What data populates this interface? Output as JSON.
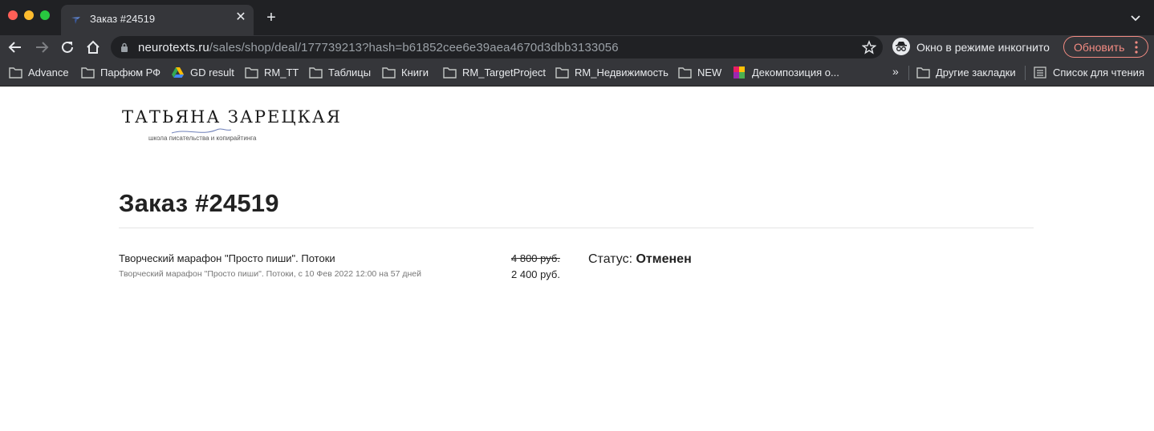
{
  "browser": {
    "tab_title": "Заказ #24519",
    "url_host": "neurotexts.ru",
    "url_path": "/sales/shop/deal/177739213?hash=b61852cee6e39aea4670d3dbb3133056",
    "incognito_label": "Окно в режиме инкогнито",
    "update_label": "Обновить",
    "bookmarks": [
      {
        "label": "Advance",
        "icon": "folder-icon"
      },
      {
        "label": "Парфюм РФ",
        "icon": "folder-icon"
      },
      {
        "label": "GD result",
        "icon": "google-drive-icon"
      },
      {
        "label": "RM_TT",
        "icon": "folder-icon"
      },
      {
        "label": "Таблицы",
        "icon": "folder-icon"
      },
      {
        "label": "Книги",
        "icon": "folder-icon"
      },
      {
        "label": "RM_TargetProject",
        "icon": "folder-icon"
      },
      {
        "label": "RM_Недвижимость",
        "icon": "folder-icon"
      },
      {
        "label": "NEW",
        "icon": "folder-icon"
      },
      {
        "label": "Декомпозиция о...",
        "icon": "colored-grid-icon"
      }
    ],
    "bookmarks_more": "»",
    "other_bookmarks": "Другие закладки",
    "reading_list": "Список для чтения"
  },
  "logo": {
    "name": "ТАТЬЯНА ЗАРЕЦКАЯ",
    "tagline": "школа писательства и копирайтинга"
  },
  "order": {
    "title": "Заказ #24519",
    "item_name": "Творческий марафон \"Просто пиши\". Потоки",
    "item_desc": "Творческий марафон \"Просто пиши\". Потоки, с 10 Фев 2022 12:00 на 57 дней",
    "price_old": "4 800 руб.",
    "price_new": "2 400 руб.",
    "status_label": "Статус:",
    "status_value": "Отменен"
  },
  "colors": {
    "chrome_dark": "#202124",
    "chrome_toolbar": "#35363a",
    "update_accent": "#f28b82"
  }
}
